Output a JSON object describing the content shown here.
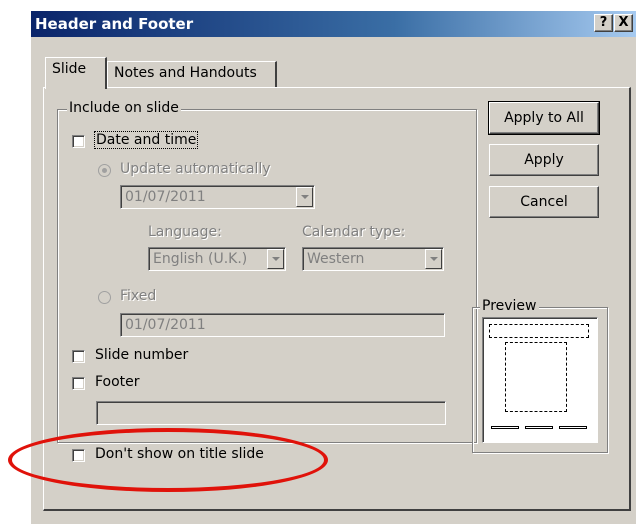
{
  "window": {
    "title": "Header and Footer",
    "help_button": "?",
    "close_button": "X"
  },
  "tabs": [
    {
      "label": "Slide",
      "active": true
    },
    {
      "label": "Notes and Handouts",
      "active": false
    }
  ],
  "include_group": {
    "legend": "Include on slide",
    "date_time": {
      "label": "Date and time",
      "checked": false
    },
    "update_automatically": {
      "label": "Update automatically",
      "selected": true,
      "enabled": false
    },
    "date_dropdown": {
      "value": "01/07/2011"
    },
    "language": {
      "label": "Language:",
      "value": "English (U.K.)"
    },
    "calendar": {
      "label": "Calendar type:",
      "value": "Western"
    },
    "fixed": {
      "label": "Fixed",
      "selected": false,
      "enabled": false
    },
    "fixed_value": "01/07/2011",
    "slide_number": {
      "label": "Slide number",
      "checked": false
    },
    "footer": {
      "label": "Footer",
      "checked": false,
      "value": ""
    },
    "dont_show": {
      "label": "Don't show on title slide",
      "checked": false
    }
  },
  "buttons": {
    "apply_all": "Apply to All",
    "apply": "Apply",
    "cancel": "Cancel"
  },
  "preview": {
    "legend": "Preview"
  },
  "annotation": {
    "color": "#e0120a",
    "shape": "oval"
  }
}
